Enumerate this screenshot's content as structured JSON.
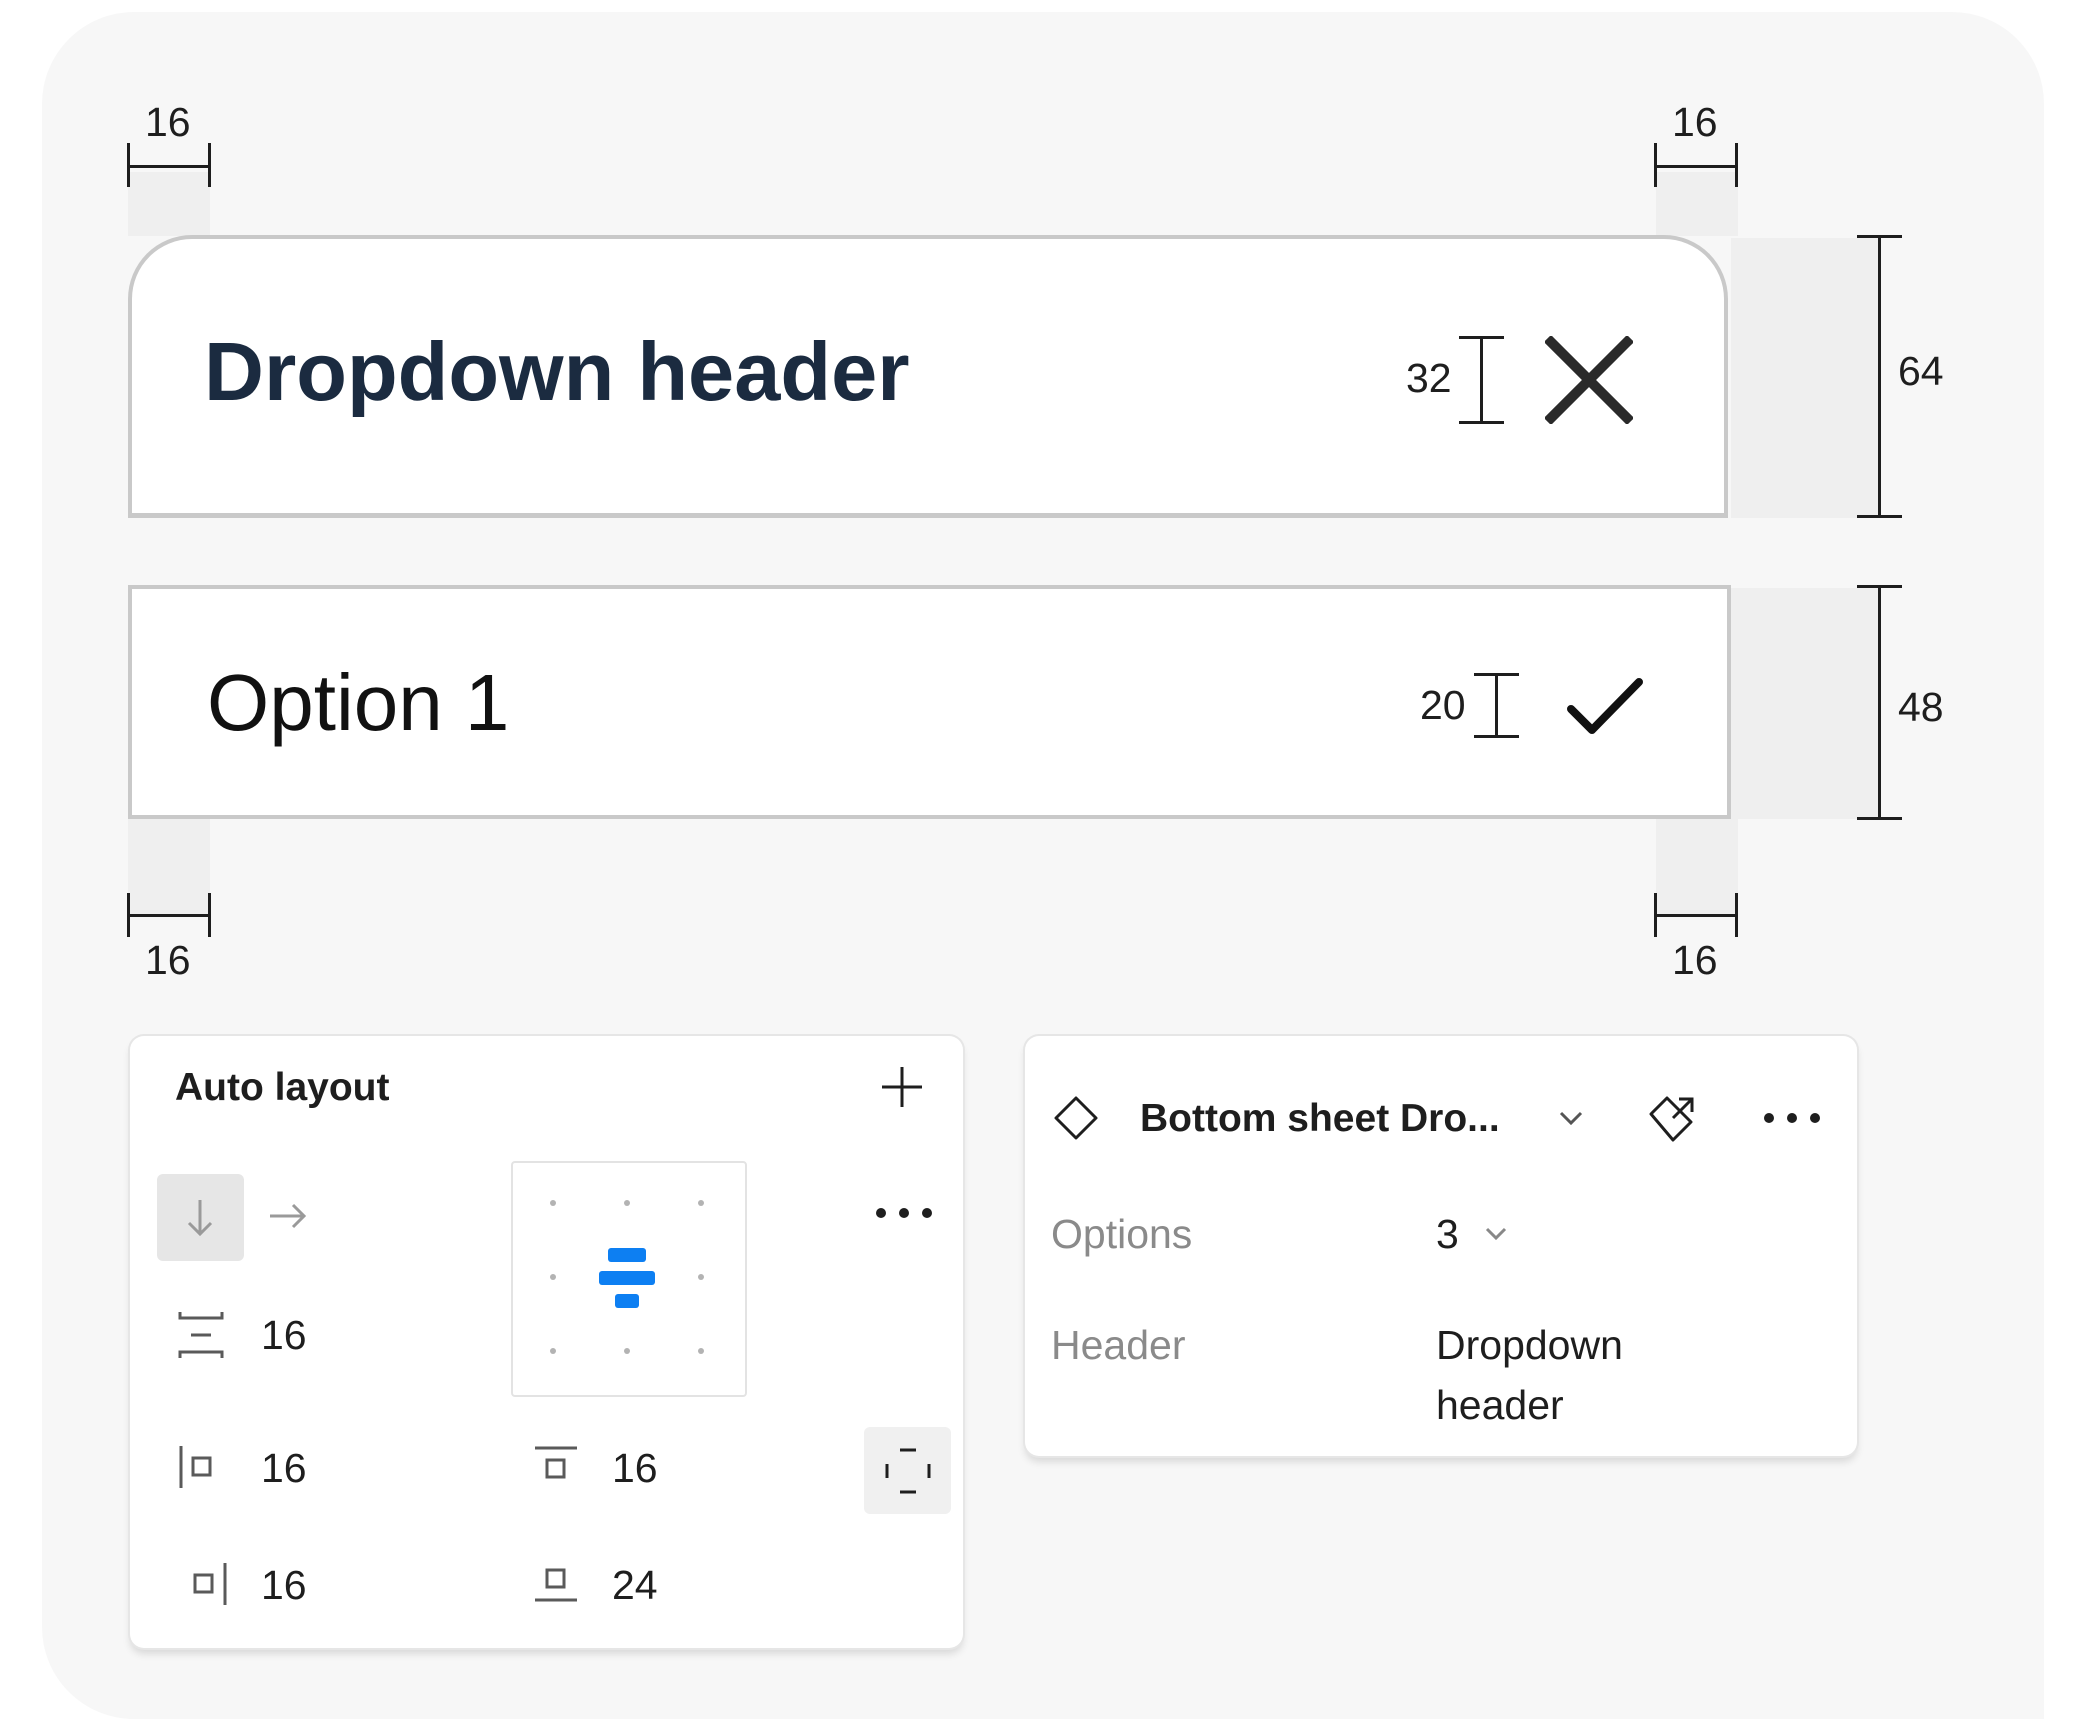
{
  "header_row": {
    "title": "Dropdown header",
    "icon_size_label": "32",
    "height_label": "64"
  },
  "option_row": {
    "label": "Option 1",
    "icon_size_label": "20",
    "height_label": "48"
  },
  "padding_labels": {
    "top_left": "16",
    "top_right": "16",
    "bottom_left": "16",
    "bottom_right": "16"
  },
  "auto_layout_panel": {
    "title": "Auto layout",
    "gap": "16",
    "padding_left": "16",
    "padding_top": "16",
    "padding_right": "16",
    "padding_bottom": "24"
  },
  "component_panel": {
    "name": "Bottom sheet Dro...",
    "props": [
      {
        "label": "Options",
        "value": "3"
      },
      {
        "label": "Header",
        "value_line1": "Dropdown",
        "value_line2": "header"
      }
    ]
  },
  "colors": {
    "accent": "#0d7ff2",
    "header_text": "#1b2b40",
    "border": "#c9c9c9"
  }
}
